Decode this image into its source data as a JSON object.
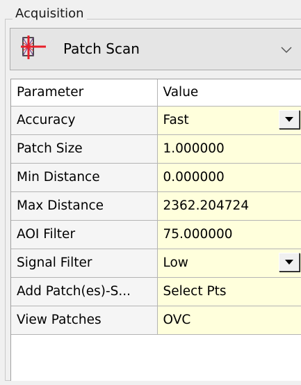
{
  "group": {
    "title": "Acquisition"
  },
  "mode_combo": {
    "selected": "Patch Scan",
    "icon": "patch-scan-icon"
  },
  "grid": {
    "columns": [
      "Parameter",
      "Value"
    ],
    "rows": [
      {
        "parameter": "Accuracy",
        "value": "Fast",
        "dropdown": true
      },
      {
        "parameter": "Patch Size",
        "value": "1.000000",
        "dropdown": false
      },
      {
        "parameter": "Min Distance",
        "value": "0.000000",
        "dropdown": false
      },
      {
        "parameter": "Max Distance",
        "value": "2362.204724",
        "dropdown": false
      },
      {
        "parameter": "AOI Filter",
        "value": "75.000000",
        "dropdown": false
      },
      {
        "parameter": "Signal Filter",
        "value": "Low",
        "dropdown": true
      },
      {
        "parameter": "Add Patch(es)-S...",
        "value": "Select Pts",
        "dropdown": false
      },
      {
        "parameter": "View Patches",
        "value": "OVC",
        "dropdown": false
      }
    ]
  },
  "colors": {
    "value_cell_bg": "#ffffdc",
    "param_cell_bg": "#f5f5f5",
    "grid_line": "#b4b4b4",
    "window_bg": "#f0f0f0",
    "icon_red": "#e8202a"
  }
}
